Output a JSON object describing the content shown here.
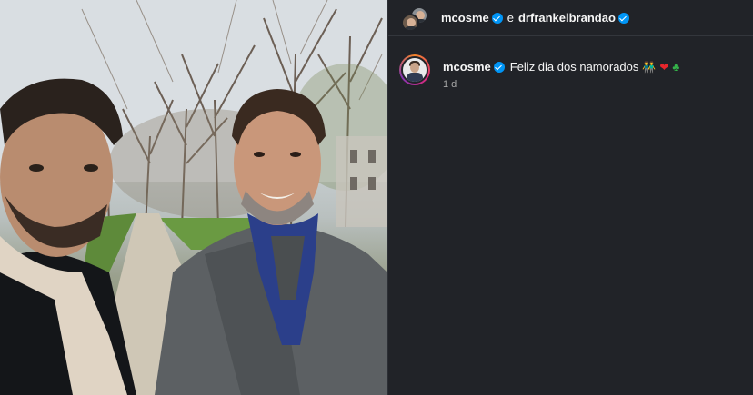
{
  "post": {
    "photo_alt": "selfie",
    "header": {
      "username_1": "mcosme",
      "conjunction": "e",
      "username_2": "drfrankelbrandao"
    },
    "caption": {
      "username": "mcosme",
      "text": "Feliz dia dos namorados",
      "emojis": [
        "couple-emoji",
        "red-heart-emoji",
        "four-leaf-clover-emoji"
      ],
      "emoji_glyphs": {
        "couple": "👬",
        "heart": "❤",
        "clover": "♣"
      },
      "time_ago": "1 d"
    }
  },
  "colors": {
    "panel_bg": "#212328",
    "verified_badge": "#0095f6",
    "muted_text": "#a8a8a8"
  }
}
